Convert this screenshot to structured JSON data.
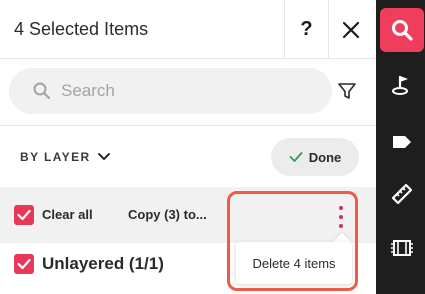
{
  "header": {
    "title": "4 Selected Items",
    "help_label": "?",
    "help_icon": "question-mark-icon",
    "close_icon": "close-icon"
  },
  "search": {
    "placeholder": "Search",
    "icon": "search-icon",
    "filter_icon": "filter-icon"
  },
  "grouping": {
    "label": "BY LAYER",
    "icon": "chevron-down-icon"
  },
  "done_button": {
    "label": "Done",
    "icon": "checkmark-icon"
  },
  "selection_bar": {
    "clear_all_label": "Clear all",
    "clear_all_checked": true,
    "copy_label": "Copy (3) to...",
    "more_icon": "kebab-menu-icon"
  },
  "layer": {
    "label": "Unlayered (1/1)",
    "checked": true
  },
  "context_menu": {
    "items": [
      {
        "label": "Delete 4 items"
      }
    ]
  },
  "toolbar": {
    "tools": [
      {
        "name": "search",
        "icon": "search-icon",
        "active": true
      },
      {
        "name": "map-pin",
        "icon": "map-pin-icon",
        "active": false
      },
      {
        "name": "tag",
        "icon": "tag-icon",
        "active": false
      },
      {
        "name": "ruler",
        "icon": "ruler-icon",
        "active": false
      },
      {
        "name": "film",
        "icon": "film-icon",
        "active": false
      }
    ]
  },
  "colors": {
    "accent": "#e8385a",
    "highlight_border": "#ef5a4b",
    "toolbar_bg": "#1e1e1e",
    "done_check": "#2e9e5b"
  }
}
